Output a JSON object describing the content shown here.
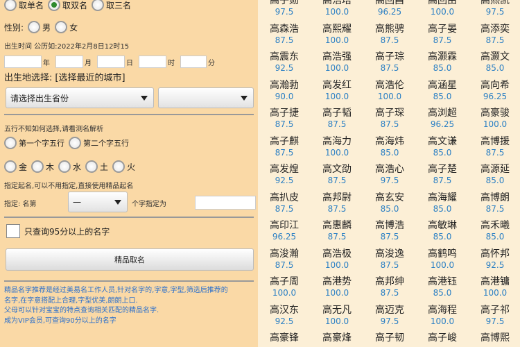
{
  "name_type_options": [
    {
      "label": "取单名",
      "checked": false
    },
    {
      "label": "取双名",
      "checked": true
    },
    {
      "label": "取三名",
      "checked": false
    }
  ],
  "gender": {
    "label": "性别:",
    "options": [
      {
        "label": "男",
        "checked": false
      },
      {
        "label": "女",
        "checked": false
      }
    ]
  },
  "birth_time": {
    "label": "出生时间 公历如:2022年2月8日12时15",
    "units": [
      "年",
      "月",
      "日",
      "时",
      "分"
    ]
  },
  "birthplace": {
    "label": "出生地选择:",
    "link": "[选择最近的城市]",
    "province_placeholder": "请选择出生省份",
    "city_value": ""
  },
  "wuxing": {
    "hint": "五行不知如何选择,请看测名解析",
    "position_options": [
      {
        "label": "第一个字五行",
        "checked": false
      },
      {
        "label": "第二个字五行",
        "checked": false
      }
    ],
    "elements": [
      {
        "label": "金",
        "checked": false
      },
      {
        "label": "木",
        "checked": false
      },
      {
        "label": "水",
        "checked": false
      },
      {
        "label": "土",
        "checked": false
      },
      {
        "label": "火",
        "checked": false
      }
    ]
  },
  "specify": {
    "hint": "指定起名,可以不用指定,直接使用精品起名",
    "label": "指定:  名第",
    "select_value": "一",
    "suffix": "个字指定为"
  },
  "only95": {
    "label": "只查询95分以上的名字",
    "checked": false
  },
  "premium_button": "精品取名",
  "footer_lines": [
    "精品名字推荐是经过美易名工作人员,针对名字的,字意,字型,筛选后推荐的",
    "名字,在字意搭配上合理,字型优美,朗朗上口.",
    "父母可以针对宝宝的特点查询相关匹配的精品名字.",
    "成为VIP会员,可查询90分以上的名字"
  ],
  "name_grid": [
    [
      {
        "name": "高子勋",
        "score": "97.5"
      },
      {
        "name": "高浩培",
        "score": "100.0"
      },
      {
        "name": "高回昌",
        "score": "96.25"
      },
      {
        "name": "高回由",
        "score": "100.0"
      },
      {
        "name": "高熙凯",
        "score": "97.5"
      }
    ],
    [
      {
        "name": "高森浩",
        "score": "87.5"
      },
      {
        "name": "高熙耀",
        "score": "100.0"
      },
      {
        "name": "高熊骋",
        "score": "87.5"
      },
      {
        "name": "高子晏",
        "score": "87.5"
      },
      {
        "name": "高添奕",
        "score": "87.5"
      }
    ],
    [
      {
        "name": "高震东",
        "score": "92.5"
      },
      {
        "name": "高浩强",
        "score": "100.0"
      },
      {
        "name": "高子琮",
        "score": "87.5"
      },
      {
        "name": "高灏霖",
        "score": "85.0"
      },
      {
        "name": "高灏文",
        "score": "85.0"
      }
    ],
    [
      {
        "name": "高瀚勃",
        "score": "90.0"
      },
      {
        "name": "高发红",
        "score": "100.0"
      },
      {
        "name": "高浩伦",
        "score": "100.0"
      },
      {
        "name": "高涵星",
        "score": "85.0"
      },
      {
        "name": "高向希",
        "score": "96.25"
      }
    ],
    [
      {
        "name": "高子捷",
        "score": "87.5"
      },
      {
        "name": "高子韬",
        "score": "87.5"
      },
      {
        "name": "高子琛",
        "score": "87.5"
      },
      {
        "name": "高浏超",
        "score": "96.25"
      },
      {
        "name": "高豪骏",
        "score": "100.0"
      }
    ],
    [
      {
        "name": "高子麒",
        "score": "87.5"
      },
      {
        "name": "高海力",
        "score": "100.0"
      },
      {
        "name": "高海炜",
        "score": "85.0"
      },
      {
        "name": "高文谦",
        "score": "85.0"
      },
      {
        "name": "高博援",
        "score": "87.5"
      }
    ],
    [
      {
        "name": "高发煌",
        "score": "92.5"
      },
      {
        "name": "高文劭",
        "score": "87.5"
      },
      {
        "name": "高浩心",
        "score": "97.5"
      },
      {
        "name": "高子楚",
        "score": "87.5"
      },
      {
        "name": "高源延",
        "score": "85.0"
      }
    ],
    [
      {
        "name": "高扒皮",
        "score": "87.5"
      },
      {
        "name": "高邦尉",
        "score": "87.5"
      },
      {
        "name": "高玄安",
        "score": "85.0"
      },
      {
        "name": "高海耀",
        "score": "85.0"
      },
      {
        "name": "高博朗",
        "score": "87.5"
      }
    ],
    [
      {
        "name": "高印江",
        "score": "96.25"
      },
      {
        "name": "高惠麟",
        "score": "87.5"
      },
      {
        "name": "高博浩",
        "score": "87.5"
      },
      {
        "name": "高敏琳",
        "score": "85.0"
      },
      {
        "name": "高禾曦",
        "score": "85.0"
      }
    ],
    [
      {
        "name": "高浚瀚",
        "score": "87.5"
      },
      {
        "name": "高浩极",
        "score": "100.0"
      },
      {
        "name": "高浚逸",
        "score": "87.5"
      },
      {
        "name": "高鹤鸣",
        "score": "100.0"
      },
      {
        "name": "高怀邦",
        "score": "92.5"
      }
    ],
    [
      {
        "name": "高子周",
        "score": "100.0"
      },
      {
        "name": "高港势",
        "score": "100.0"
      },
      {
        "name": "高邦绅",
        "score": "87.5"
      },
      {
        "name": "高港钰",
        "score": "85.0"
      },
      {
        "name": "高港镛",
        "score": "100.0"
      }
    ],
    [
      {
        "name": "高汉东",
        "score": "92.5"
      },
      {
        "name": "高无凡",
        "score": "100.0"
      },
      {
        "name": "高迈克",
        "score": "97.5"
      },
      {
        "name": "高海程",
        "score": "100.0"
      },
      {
        "name": "高子祁",
        "score": "97.5"
      }
    ],
    [
      {
        "name": "高豪锋",
        "score": ""
      },
      {
        "name": "高豪烽",
        "score": ""
      },
      {
        "name": "高子韧",
        "score": ""
      },
      {
        "name": "高子峻",
        "score": ""
      },
      {
        "name": "高博熙",
        "score": ""
      }
    ]
  ]
}
